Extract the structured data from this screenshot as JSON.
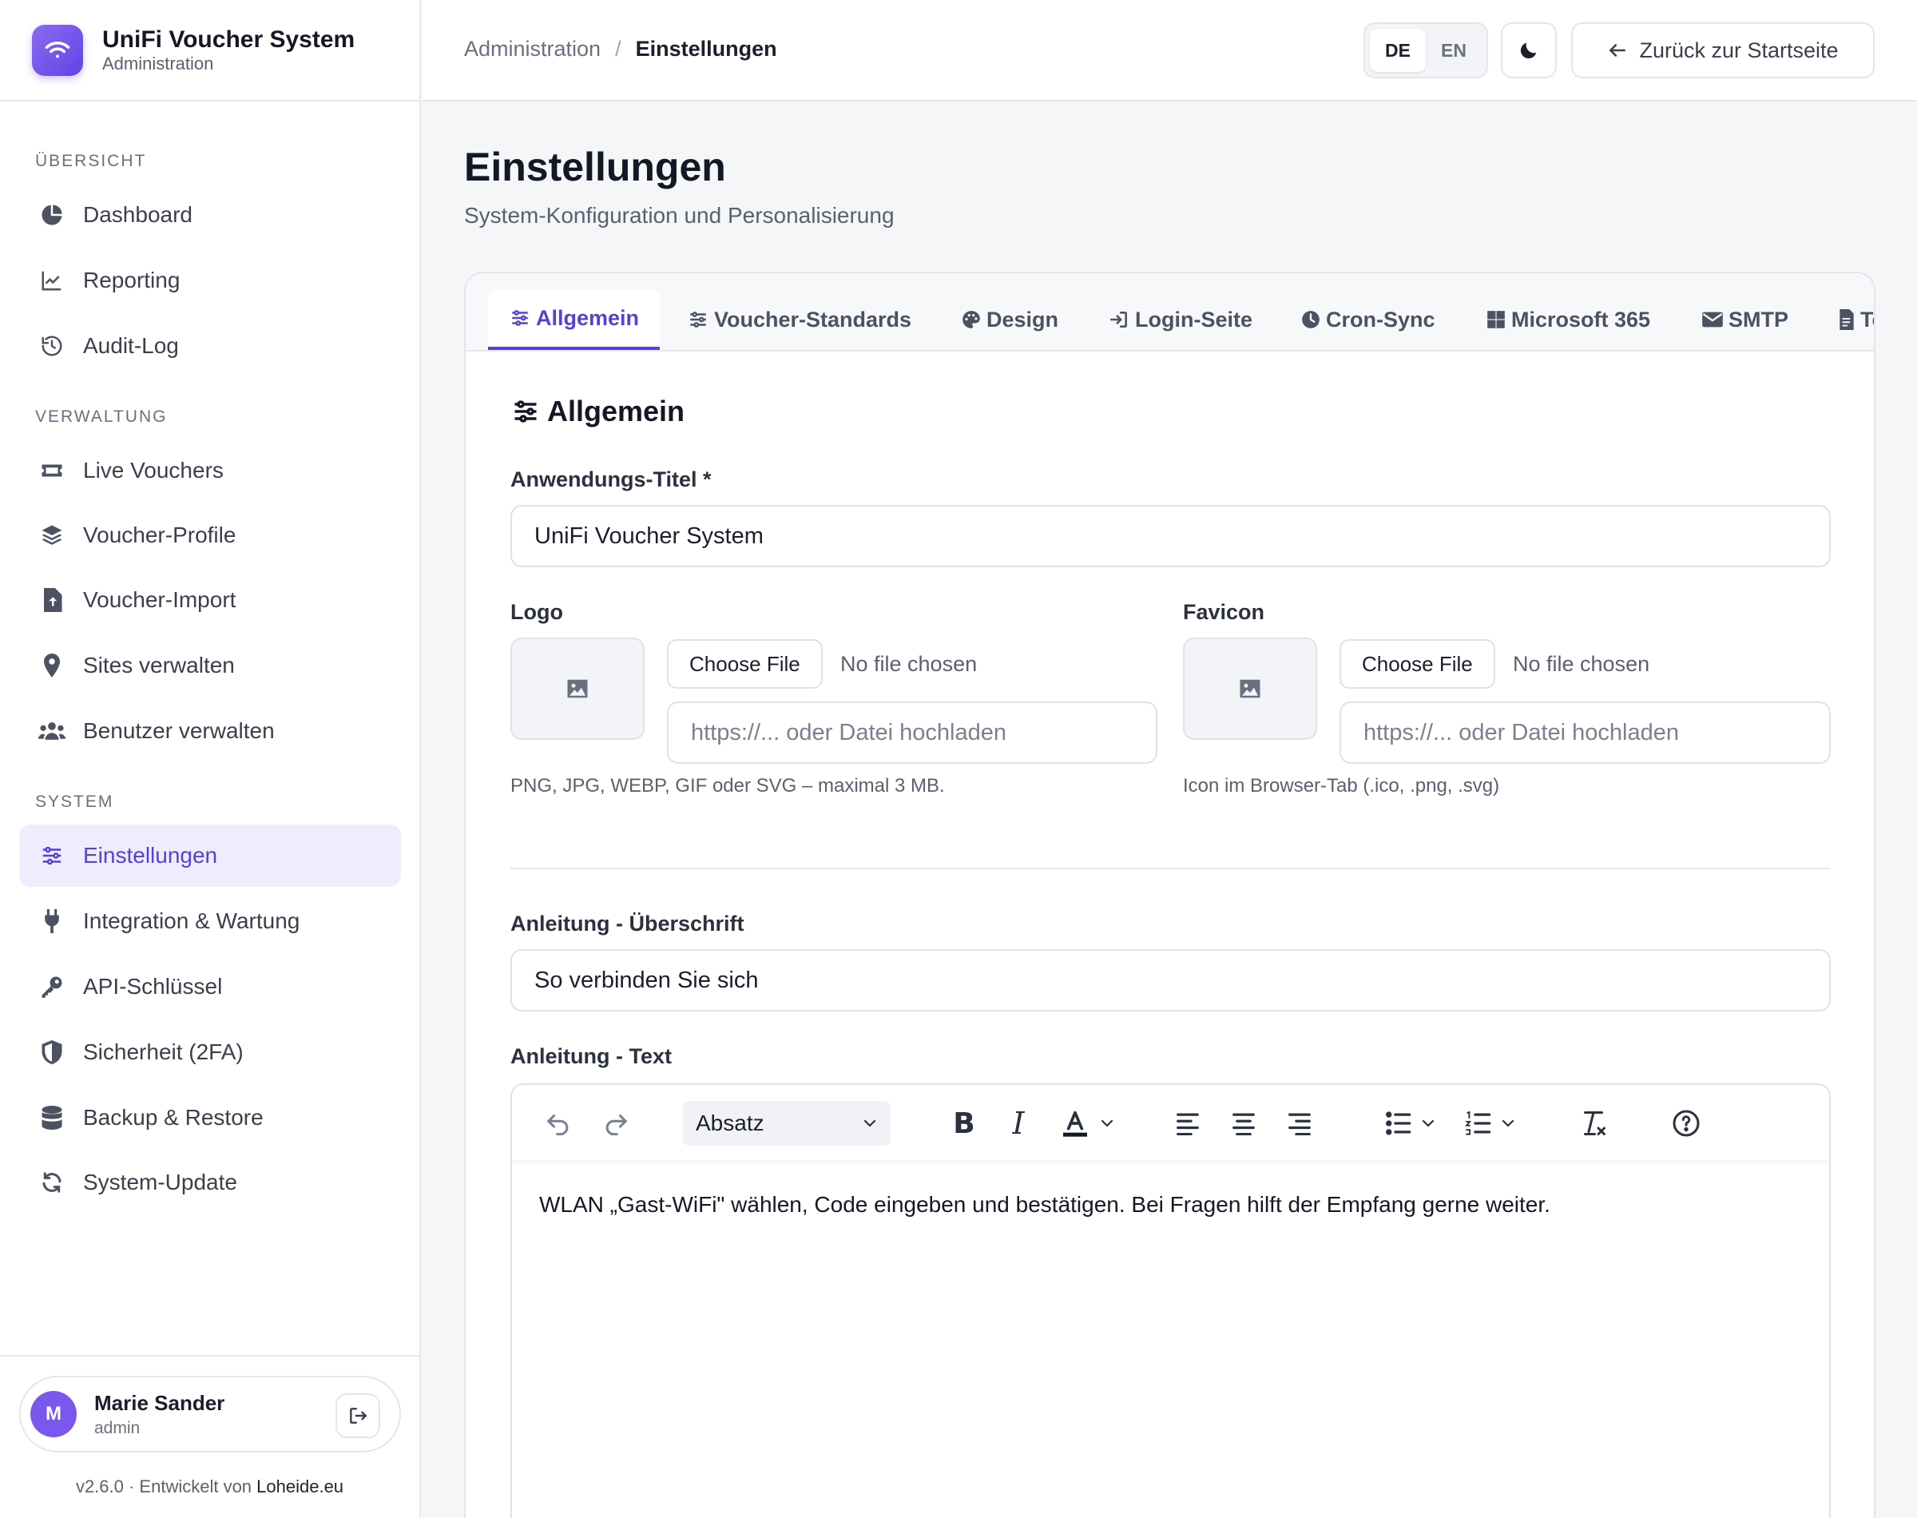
{
  "brand": {
    "title": "UniFi Voucher System",
    "subtitle": "Administration"
  },
  "nav": {
    "sections": [
      {
        "label": "ÜBERSICHT",
        "items": [
          "Dashboard",
          "Reporting",
          "Audit-Log"
        ]
      },
      {
        "label": "VERWALTUNG",
        "items": [
          "Live Vouchers",
          "Voucher-Profile",
          "Voucher-Import",
          "Sites verwalten",
          "Benutzer verwalten"
        ]
      },
      {
        "label": "SYSTEM",
        "items": [
          "Einstellungen",
          "Integration & Wartung",
          "API-Schlüssel",
          "Sicherheit (2FA)",
          "Backup & Restore",
          "System-Update"
        ]
      }
    ],
    "active": "Einstellungen"
  },
  "user": {
    "initial": "M",
    "name": "Marie Sander",
    "role": "admin"
  },
  "footer": {
    "version": "v2.6.0 · Entwickelt von ",
    "vendor": "Loheide.eu"
  },
  "header": {
    "breadcrumb": [
      "Administration",
      "Einstellungen"
    ],
    "separator": "/",
    "languages": [
      "DE",
      "EN"
    ],
    "active_language": "DE",
    "back_label": "Zurück zur Startseite"
  },
  "page": {
    "title": "Einstellungen",
    "subtitle": "System-Konfiguration und Personalisierung"
  },
  "tabs": [
    "Allgemein",
    "Voucher-Standards",
    "Design",
    "Login-Seite",
    "Cron-Sync",
    "Microsoft 365",
    "SMTP",
    "Te"
  ],
  "active_tab": "Allgemein",
  "general": {
    "heading": "Allgemein",
    "app_title_label": "Anwendungs-Titel *",
    "app_title_value": "UniFi Voucher System",
    "logo": {
      "label": "Logo",
      "button": "Choose File",
      "status": "No file chosen",
      "url_placeholder": "https://... oder Datei hochladen",
      "hint": "PNG, JPG, WEBP, GIF oder SVG – maximal 3 MB."
    },
    "favicon": {
      "label": "Favicon",
      "button": "Choose File",
      "status": "No file chosen",
      "url_placeholder": "https://... oder Datei hochladen",
      "hint": "Icon im Browser-Tab (.ico, .png, .svg)"
    },
    "guide_heading_label": "Anleitung - Überschrift",
    "guide_heading_value": "So verbinden Sie sich",
    "guide_text_label": "Anleitung - Text",
    "editor": {
      "format_value": "Absatz",
      "body": "WLAN „Gast-WiFi\" wählen, Code eingeben und bestätigen. Bei Fragen hilft der Empfang gerne weiter."
    }
  },
  "colors": {
    "accent": "#5a3fd6",
    "accent_bg": "#efedfd",
    "avatar": "#7a58ee"
  }
}
